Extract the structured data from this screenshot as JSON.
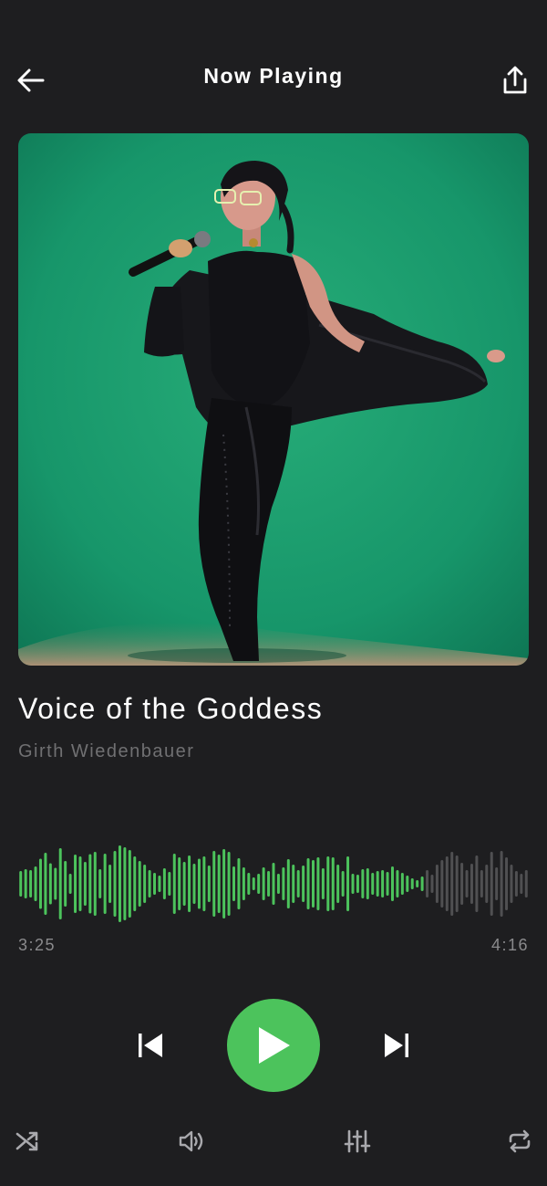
{
  "header": {
    "title": "Now Playing",
    "back_icon": "arrow-left-icon",
    "share_icon": "share-icon"
  },
  "track": {
    "title": "Voice of the Goddess",
    "artist": "Girth Wiedenbauer",
    "artwork": "singer-with-microphone-on-green-background"
  },
  "progress": {
    "elapsed": "3:25",
    "total": "4:16",
    "played_fraction": 0.8
  },
  "waveform": {
    "levels": [
      0.28,
      0.32,
      0.3,
      0.38,
      0.55,
      0.68,
      0.45,
      0.35,
      0.78,
      0.5,
      0.22,
      0.64,
      0.6,
      0.48,
      0.65,
      0.7,
      0.32,
      0.66,
      0.42,
      0.72,
      0.84,
      0.8,
      0.74,
      0.6,
      0.5,
      0.42,
      0.3,
      0.24,
      0.18,
      0.34,
      0.26,
      0.66,
      0.58,
      0.48,
      0.62,
      0.44,
      0.55,
      0.6,
      0.4,
      0.72,
      0.64,
      0.76,
      0.7,
      0.38,
      0.56,
      0.36,
      0.24,
      0.14,
      0.22,
      0.36,
      0.28,
      0.46,
      0.22,
      0.36,
      0.54,
      0.42,
      0.3,
      0.4,
      0.56,
      0.52,
      0.58,
      0.34,
      0.6,
      0.58,
      0.42,
      0.28,
      0.6,
      0.22,
      0.2,
      0.32,
      0.34,
      0.24,
      0.28,
      0.3,
      0.26,
      0.38,
      0.3,
      0.24,
      0.18,
      0.12,
      0.08,
      0.16,
      0.3,
      0.2,
      0.42,
      0.52,
      0.6,
      0.7,
      0.62,
      0.46,
      0.3,
      0.44,
      0.62,
      0.3,
      0.42,
      0.7,
      0.36,
      0.72,
      0.58,
      0.42,
      0.28,
      0.22,
      0.3
    ],
    "played_color": "#4cc35c",
    "unplayed_color": "#505052"
  },
  "controls": {
    "previous_icon": "skip-previous-icon",
    "play_icon": "play-icon",
    "next_icon": "skip-next-icon",
    "shuffle_icon": "shuffle-icon",
    "volume_icon": "volume-icon",
    "equalizer_icon": "equalizer-icon",
    "repeat_icon": "repeat-icon"
  },
  "colors": {
    "accent": "#4cc35c",
    "background": "#1e1e20",
    "secondary_text": "#707072",
    "time_text": "#8a8a8c"
  }
}
